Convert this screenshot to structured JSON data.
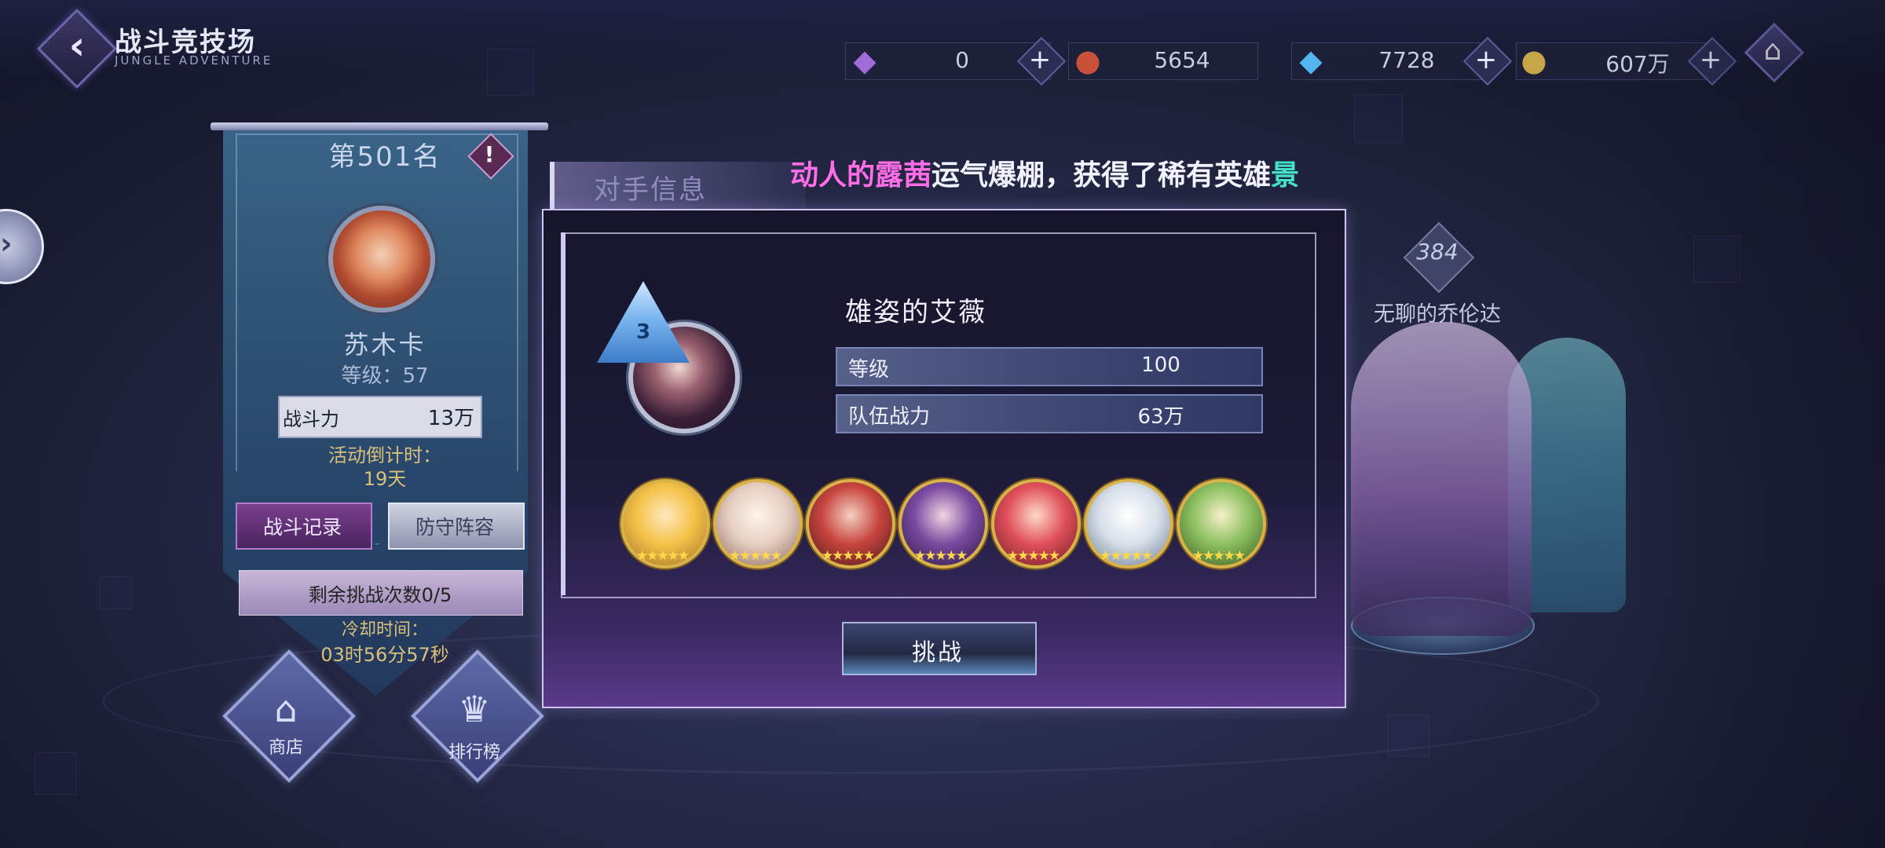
{
  "header": {
    "title": "战斗竞技场",
    "subtitle": "JUNGLE ADVENTURE"
  },
  "resources": [
    {
      "icon": "purple-crystal-icon",
      "value": "0"
    },
    {
      "icon": "red-medal-icon",
      "value": "5654"
    },
    {
      "icon": "blue-diamond-icon",
      "value": "7728"
    },
    {
      "icon": "gold-coin-icon",
      "value": "607万"
    }
  ],
  "player": {
    "rank": "第501名",
    "info_badge": "!",
    "name": "苏木卡",
    "level": "等级：57",
    "power_label": "战斗力",
    "power_value": "13万",
    "countdown_label": "活动倒计时：",
    "countdown_value": "19天",
    "record_button": "战斗记录",
    "defense_button": "防守阵容",
    "remaining": "剩余挑战次数0/5",
    "cooldown_label": "冷却时间：",
    "cooldown_value": "03时56分57秒",
    "shop_label": "商店",
    "ranking_label": "排行榜"
  },
  "opponent_tab": "对手信息",
  "announcement": {
    "part1": "动人的",
    "part2": "露茜",
    "part3": "运气爆棚，获得了稀有英雄",
    "part4": "景"
  },
  "modal": {
    "rank_badge": "3",
    "name": "雄姿的艾薇",
    "level_label": "等级",
    "level_value": "100",
    "power_label": "队伍战力",
    "power_value": "63万",
    "heroes": [
      {
        "stars": "★★★★★",
        "color": "#f4c247"
      },
      {
        "stars": "★★★★★",
        "color": "#e6cfc2"
      },
      {
        "stars": "★★★★★",
        "color": "#c8443e"
      },
      {
        "stars": "★★★★★",
        "color": "#7a4aa0"
      },
      {
        "stars": "★★★★★",
        "color": "#e0505a"
      },
      {
        "stars": "★★★★★",
        "color": "#d8e0ea"
      },
      {
        "stars": "★★★★★",
        "color": "#8cc060"
      }
    ],
    "challenge_button": "挑战"
  },
  "right_opponent": {
    "level": "384",
    "name": "无聊的乔伦达"
  },
  "colors": {
    "accent_pink": "#ff6ee6",
    "accent_gold": "#d8c07a",
    "accent_teal": "#45e2c8"
  }
}
